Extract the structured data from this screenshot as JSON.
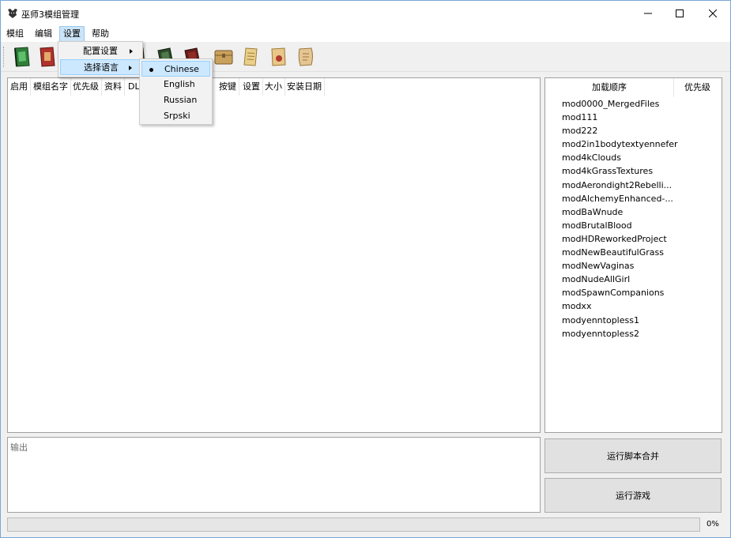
{
  "window": {
    "title": "巫师3模组管理"
  },
  "menubar": {
    "items": [
      "模组",
      "编辑",
      "设置",
      "帮助"
    ]
  },
  "settings_menu": {
    "items": [
      "配置设置",
      "选择语言"
    ]
  },
  "language_menu": {
    "items": [
      "Chinese",
      "English",
      "Russian",
      "Srpski"
    ],
    "selected": "Chinese"
  },
  "mod_table": {
    "columns": [
      "启用",
      "模组名字",
      "优先级",
      "资料",
      "DL",
      "按键",
      "设置",
      "大小",
      "安装日期"
    ]
  },
  "load_order": {
    "header_order": "加载顺序",
    "header_priority": "优先级",
    "items": [
      "mod0000_MergedFiles",
      "mod111",
      "mod222",
      "mod2in1bodytextyennefer",
      "mod4kClouds",
      "mod4kGrassTextures",
      "modAerondight2Rebelli...",
      "modAlchemyEnhanced-...",
      "modBaWnude",
      "modBrutalBlood",
      "modHDReworkedProject",
      "modNewBeautifulGrass",
      "modNewVaginas",
      "modNudeAllGirl",
      "modSpawnCompanions",
      "modxx",
      "modyenntopless1",
      "modyenntopless2"
    ]
  },
  "output": {
    "label": "输出"
  },
  "buttons": {
    "merge": "运行脚本合并",
    "run_game": "运行游戏"
  },
  "progress": {
    "value": 0,
    "text": "0%"
  },
  "icons": {
    "toolbar": [
      "green-book-icon",
      "red-book-icon",
      "brown-book-icon",
      "green-tome-icon",
      "red-tome-icon",
      "chest-icon",
      "scroll-icon",
      "letter-icon",
      "parchment-icon"
    ]
  },
  "colors": {
    "menu_highlight": "#cce8ff",
    "accent_border": "#99d1ff",
    "progress_fill": "#06b025"
  }
}
